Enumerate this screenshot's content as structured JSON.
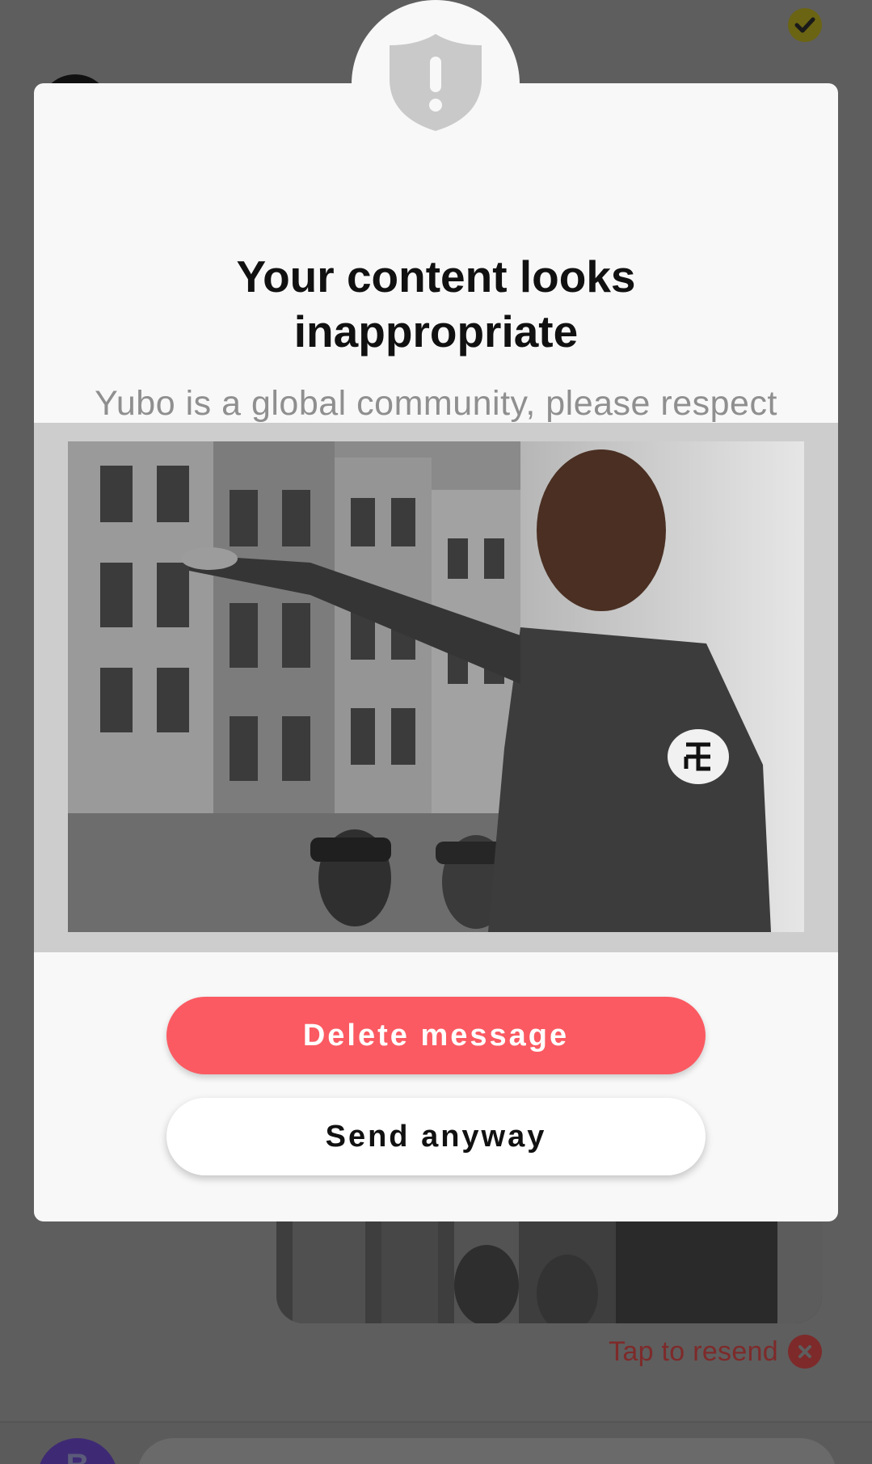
{
  "modal": {
    "icon": "shield-exclamation-icon",
    "title": "Your content looks inappropriate",
    "subtitle": "Yubo is a global community, please respect everyone.",
    "preview_image": "flagged-image-preview",
    "delete_label": "Delete message",
    "send_label": "Send anyway"
  },
  "chat": {
    "status_icon": "check-icon",
    "resend_label": "Tap to resend",
    "resend_icon": "close-circle-icon",
    "composer_avatar_initial": "B"
  },
  "colors": {
    "primary": "#fb5a62",
    "overlay": "#5e5e5e",
    "modal_bg": "#f8f8f8",
    "title": "#111111",
    "subtitle": "#8f8f8f",
    "resend": "#7e2a2a"
  }
}
